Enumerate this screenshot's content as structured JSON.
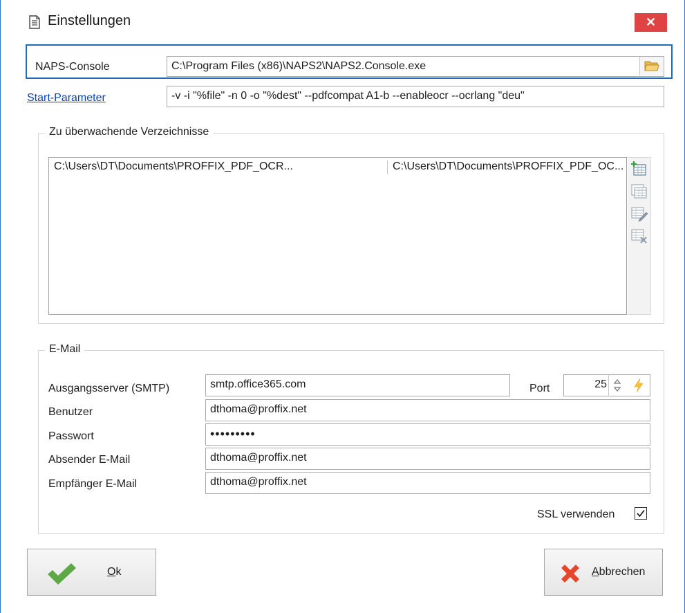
{
  "window": {
    "title": "Einstellungen",
    "close_symbol": "✕",
    "icon": "document-icon",
    "accent_color": "#2b79c2",
    "close_color": "#e04343"
  },
  "naps": {
    "label": "NAPS-Console",
    "path": "C:\\Program Files (x86)\\NAPS2\\NAPS2.Console.exe",
    "browse_icon": "folder-icon"
  },
  "start": {
    "label": "Start-Parameter",
    "value": "-v -i \"%file\" -n 0 -o \"%dest\" --pdfcompat A1-b --enableocr --ocrlang \"deu\""
  },
  "dirs": {
    "group_title": "Zu überwachende Verzeichnisse",
    "rows": [
      {
        "source": "C:\\Users\\DT\\Documents\\PROFFIX_PDF_OCR...",
        "target": "C:\\Users\\DT\\Documents\\PROFFIX_PDF_OC..."
      }
    ],
    "tools": [
      "add-row-icon",
      "copy-row-icon",
      "edit-row-icon",
      "delete-row-icon"
    ]
  },
  "email": {
    "group_title": "E-Mail",
    "smtp_label": "Ausgangsserver (SMTP)",
    "smtp_value": "smtp.office365.com",
    "port_label": "Port",
    "port_value": "25",
    "user_label": "Benutzer",
    "user_value": "dthoma@proffix.net",
    "password_label": "Passwort",
    "password_value": "•••••••••",
    "sender_label": "Absender E-Mail",
    "sender_value": "dthoma@proffix.net",
    "recipient_label": "Empfänger E-Mail",
    "recipient_value": "dthoma@proffix.net",
    "ssl_label": "SSL verwenden",
    "ssl_checked": true
  },
  "buttons": {
    "ok_first": "O",
    "ok_rest": "k",
    "cancel_first": "A",
    "cancel_rest": "bbrechen",
    "ok_icon": "checkmark-icon",
    "cancel_icon": "x-icon",
    "ok_color": "#5fa846",
    "cancel_color": "#e8462c"
  }
}
